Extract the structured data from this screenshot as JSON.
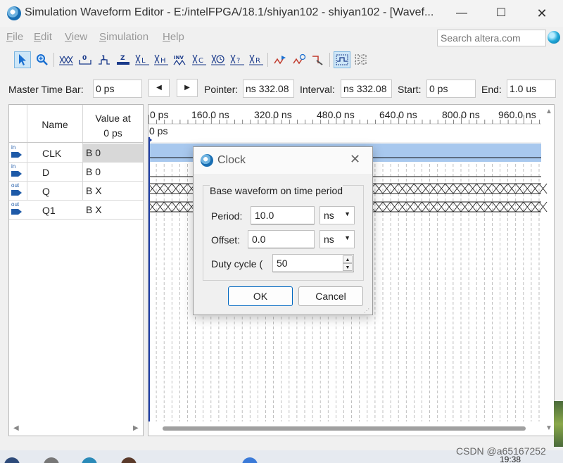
{
  "window": {
    "title": "Simulation Waveform Editor - E:/intelFPGA/18.1/shiyan102 - shiyan102 - [Wavef...",
    "min_glyph": "—",
    "max_glyph": "☐",
    "close_glyph": "✕"
  },
  "menu": {
    "file_u": "F",
    "file_rest": "ile",
    "edit_u": "E",
    "edit_rest": "dit",
    "view_u": "V",
    "view_rest": "iew",
    "simulation_u": "S",
    "simulation_rest": "imulation",
    "help_u": "H",
    "help_rest": "elp"
  },
  "search": {
    "placeholder": "Search altera.com"
  },
  "toolbar_icons": [
    "selection-tool-icon",
    "zoom-tool-icon",
    "force-unknown-icon",
    "force-low-icon",
    "force-high-icon",
    "force-high-impedance-icon",
    "force-weak-low-icon",
    "force-weak-high-icon",
    "invert-icon",
    "count-value-icon",
    "overwrite-clock-icon",
    "random-values-icon",
    "arbitrary-value-icon",
    "snap-to-grid-icon",
    "run-functional-simulation-icon",
    "run-timing-simulation-icon",
    "generate-netlist-icon",
    "grid-icon",
    "group-icon"
  ],
  "timebar": {
    "master_label": "Master Time Bar:",
    "master_value": "0 ps",
    "prev_glyph": "◀",
    "next_glyph": "▶",
    "pointer_label": "Pointer:",
    "pointer_value": "332.08 ns",
    "interval_label": "Interval:",
    "interval_value": "332.08 ns",
    "start_label": "Start:",
    "start_value": "0 ps",
    "end_label": "End:",
    "end_value": "1.0 us"
  },
  "signals": {
    "header_name": "Name",
    "header_value_line1": "Value at",
    "header_value_line2": "0 ps",
    "rows": [
      {
        "dir": "in",
        "name": "CLK",
        "value": "B 0"
      },
      {
        "dir": "in",
        "name": "D",
        "value": "B 0"
      },
      {
        "dir": "out",
        "name": "Q",
        "value": "B X"
      },
      {
        "dir": "out",
        "name": "Q1",
        "value": "B X"
      }
    ]
  },
  "waveform": {
    "ruler": [
      "0 ps",
      "160.0 ns",
      "320.0 ns",
      "480.0 ns",
      "640.0 ns",
      "800.0 ns",
      "960.0 ns"
    ],
    "pointer_time": "0 ps"
  },
  "dialog": {
    "title": "Clock",
    "close_glyph": "✕",
    "group_title": "Base waveform on time period",
    "period_label": "Period:",
    "period_value": "10.0",
    "period_unit": "ns",
    "offset_label": "Offset:",
    "offset_value": "0.0",
    "offset_unit": "ns",
    "duty_label": "Duty cycle (",
    "duty_value": "50",
    "ok_label": "OK",
    "cancel_label": "Cancel"
  },
  "footer": {
    "watermark": "CSDN @a65167252",
    "clock": "19:38"
  },
  "colors": {
    "selection_blue": "#a8c8ee",
    "pointer_line": "#1e3fa8",
    "dialog_default_border": "#0067c0"
  }
}
